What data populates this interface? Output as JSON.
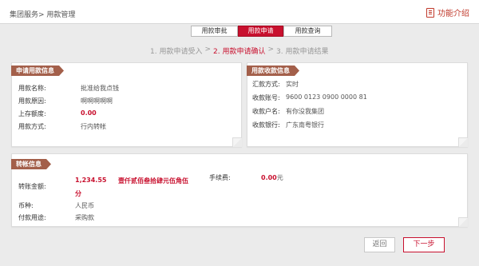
{
  "header": {
    "breadcrumb": "集团服务> 用款管理",
    "help_label": "功能介绍"
  },
  "tabs": [
    {
      "label": "用款审批"
    },
    {
      "label": "用款申请"
    },
    {
      "label": "用款查询"
    }
  ],
  "steps": [
    {
      "label": "1. 用款申请受入"
    },
    {
      "label": ">"
    },
    {
      "label": "2. 用款申请确认"
    },
    {
      "label": ">"
    },
    {
      "label": "3. 用款申请结果"
    }
  ],
  "apply_panel": {
    "title": "申请用款信息",
    "rows": [
      {
        "label": "用款名称:",
        "value": "批准给我点钱"
      },
      {
        "label": "用款原因:",
        "value": "啊啊啊啊啊"
      },
      {
        "label": "上存额度:",
        "value": "0.00"
      },
      {
        "label": "用款方式:",
        "value": "行内转帐"
      }
    ]
  },
  "receive_panel": {
    "title": "用款收款信息",
    "rows": [
      {
        "label": "汇款方式:",
        "value": "实时"
      },
      {
        "label": "收款账号:",
        "value": "9600 0123 0900 0000 81"
      },
      {
        "label": "收款户名:",
        "value": "有你没我集团"
      },
      {
        "label": "收款银行:",
        "value": "广东南粤银行"
      }
    ]
  },
  "transfer_panel": {
    "title": "转帐信息",
    "amount_label": "转账金额:",
    "amount_line1": "1,234.55",
    "amount_line2": "分",
    "amount_words": "壹仟贰佰叁拾肆元伍角伍",
    "fee_label": "手续费:",
    "fee_value": "0.00",
    "fee_unit": "元",
    "currency_label": "币种:",
    "currency_value": "人民币",
    "purpose_label": "付款用途:",
    "purpose_value": "采购款"
  },
  "buttons": {
    "back": "返回",
    "next": "下一步"
  },
  "colors": {
    "accent": "#c8102e",
    "panel_title_bg": "#a35f4a"
  }
}
